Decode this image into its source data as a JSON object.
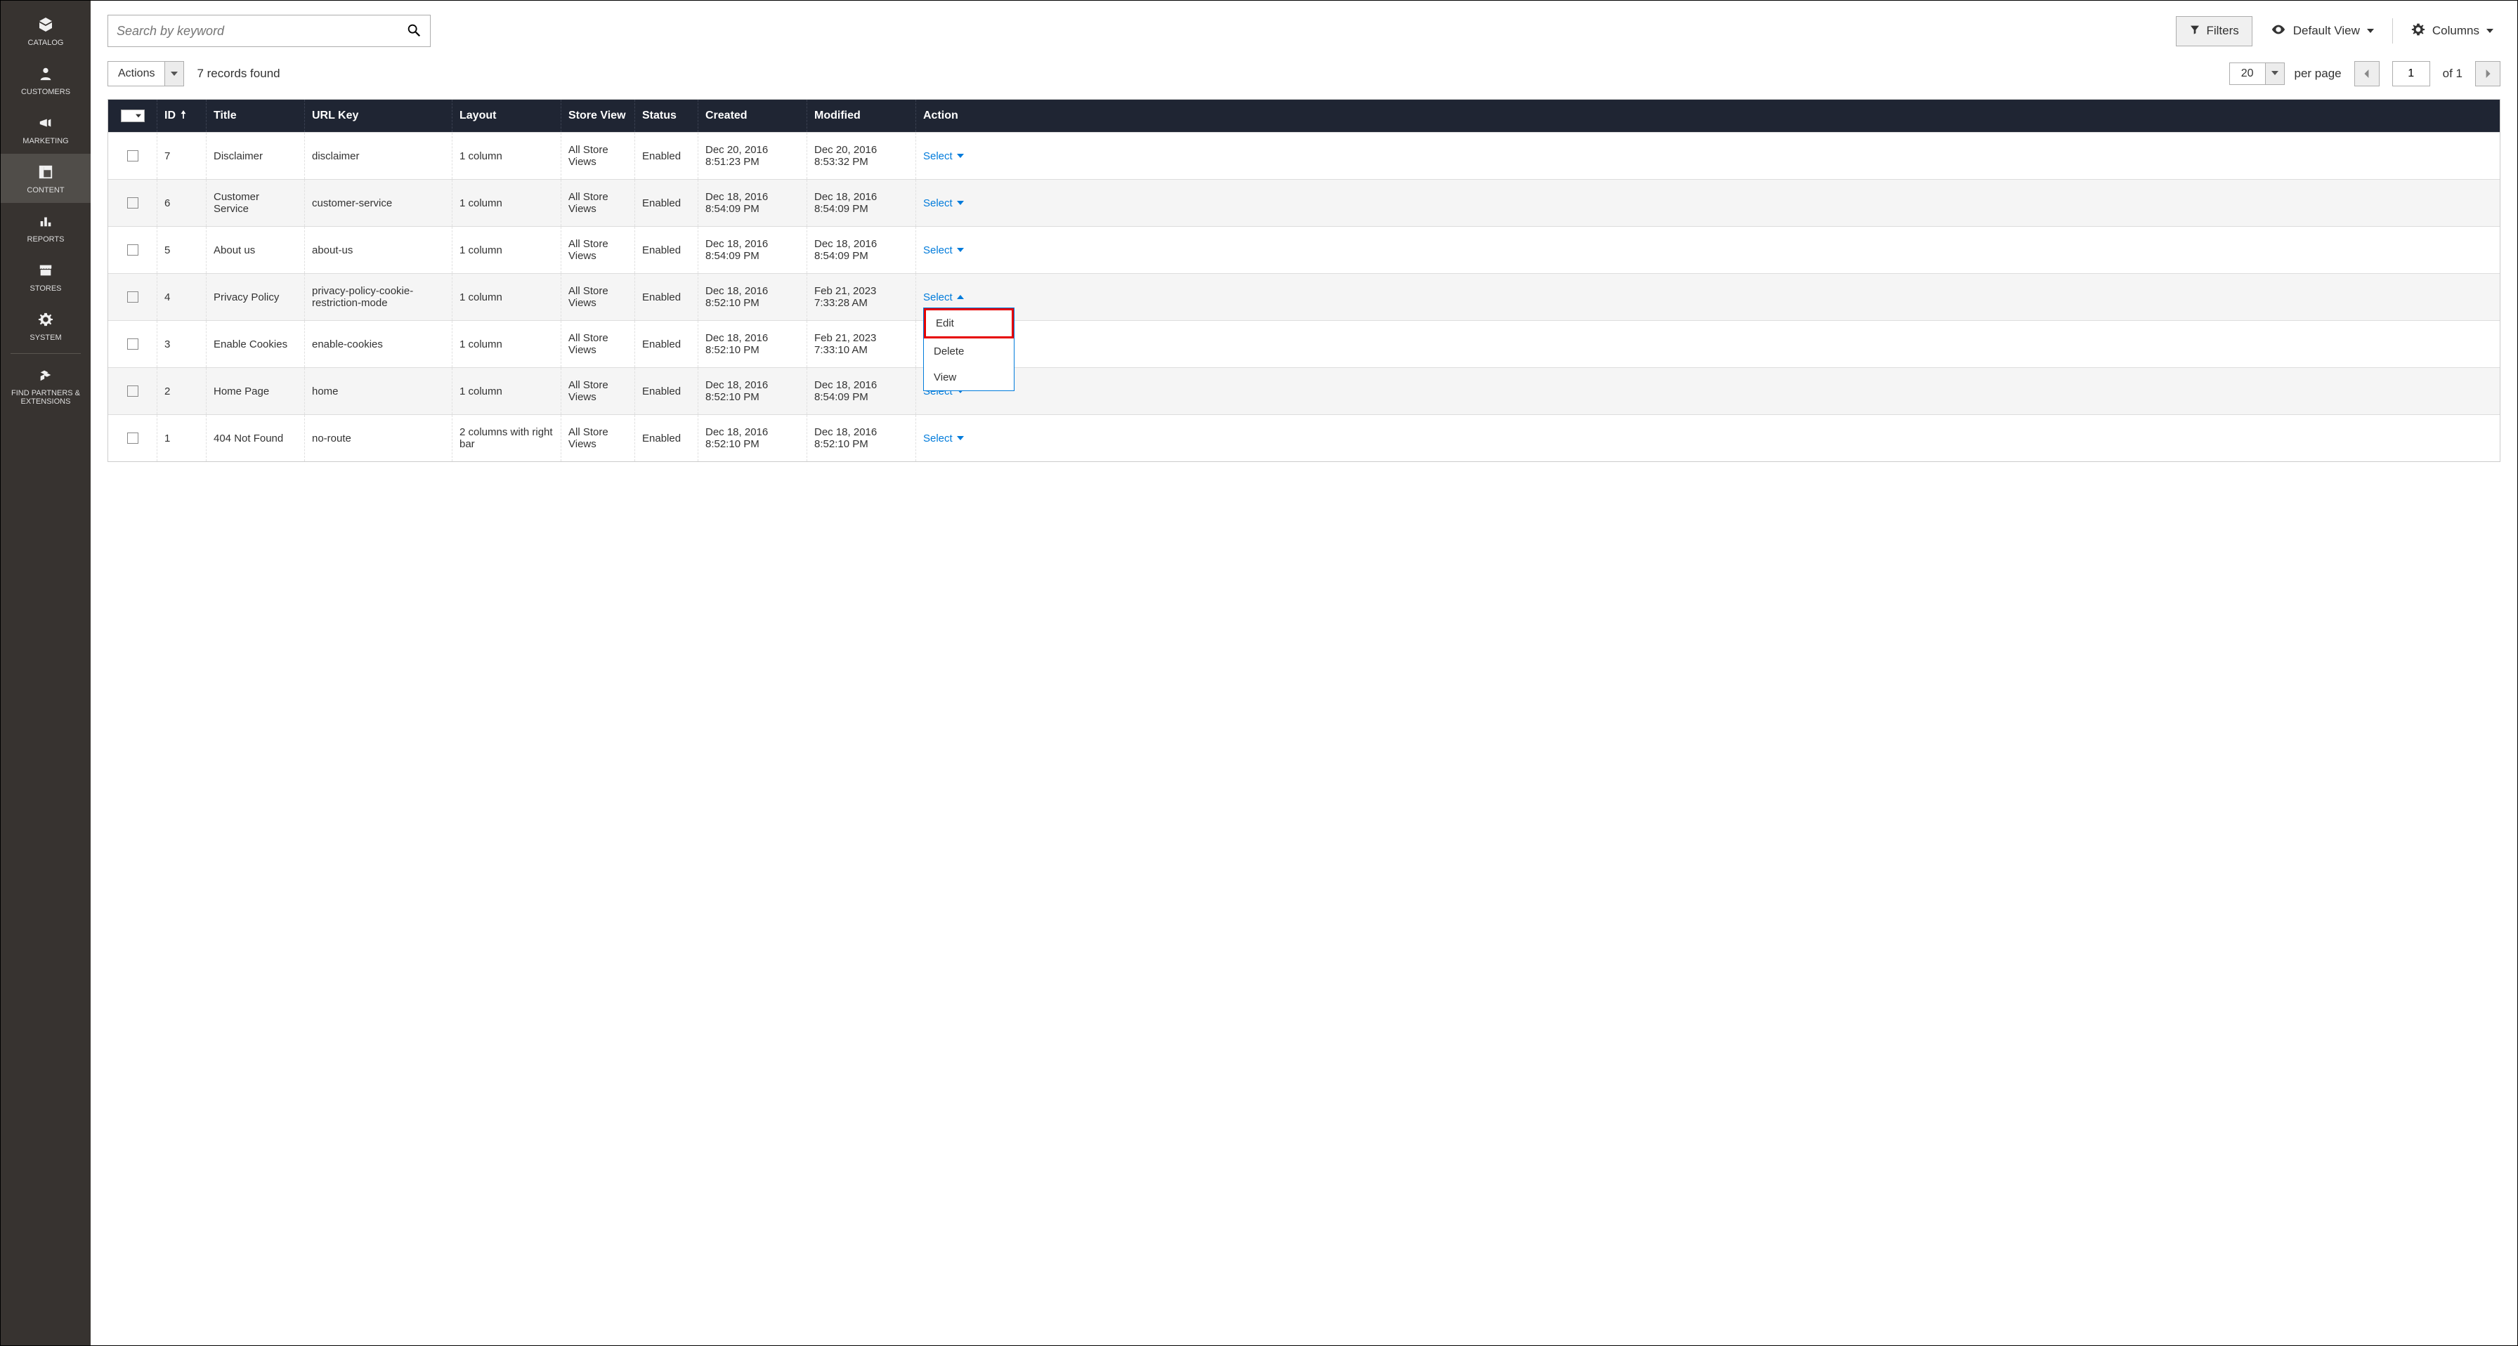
{
  "sidebar": {
    "items": [
      {
        "label": "CATALOG"
      },
      {
        "label": "CUSTOMERS"
      },
      {
        "label": "MARKETING"
      },
      {
        "label": "CONTENT"
      },
      {
        "label": "REPORTS"
      },
      {
        "label": "STORES"
      },
      {
        "label": "SYSTEM"
      },
      {
        "label": "FIND PARTNERS & EXTENSIONS"
      }
    ]
  },
  "toolbar": {
    "search_placeholder": "Search by keyword",
    "filters_label": "Filters",
    "default_view_label": "Default View",
    "columns_label": "Columns",
    "actions_label": "Actions",
    "records_found": "7 records found"
  },
  "pagination": {
    "per_page": "20",
    "per_page_label": "per page",
    "current_page": "1",
    "of_text": "of 1"
  },
  "grid": {
    "headers": [
      "ID",
      "Title",
      "URL Key",
      "Layout",
      "Store View",
      "Status",
      "Created",
      "Modified",
      "Action"
    ],
    "select_label": "Select",
    "rows": [
      {
        "id": "7",
        "title": "Disclaimer",
        "url_key": "disclaimer",
        "layout": "1 column",
        "store": "All Store Views",
        "status": "Enabled",
        "created": "Dec 20, 2016 8:51:23 PM",
        "modified": "Dec 20, 2016 8:53:32 PM",
        "open": false
      },
      {
        "id": "6",
        "title": "Customer Service",
        "url_key": "customer-service",
        "layout": "1 column",
        "store": "All Store Views",
        "status": "Enabled",
        "created": "Dec 18, 2016 8:54:09 PM",
        "modified": "Dec 18, 2016 8:54:09 PM",
        "open": false
      },
      {
        "id": "5",
        "title": "About us",
        "url_key": "about-us",
        "layout": "1 column",
        "store": "All Store Views",
        "status": "Enabled",
        "created": "Dec 18, 2016 8:54:09 PM",
        "modified": "Dec 18, 2016 8:54:09 PM",
        "open": false
      },
      {
        "id": "4",
        "title": "Privacy Policy",
        "url_key": "privacy-policy-cookie-restriction-mode",
        "layout": "1 column",
        "store": "All Store Views",
        "status": "Enabled",
        "created": "Dec 18, 2016 8:52:10 PM",
        "modified": "Feb 21, 2023 7:33:28 AM",
        "open": true
      },
      {
        "id": "3",
        "title": "Enable Cookies",
        "url_key": "enable-cookies",
        "layout": "1 column",
        "store": "All Store Views",
        "status": "Enabled",
        "created": "Dec 18, 2016 8:52:10 PM",
        "modified": "Feb 21, 2023 7:33:10 AM",
        "open": false
      },
      {
        "id": "2",
        "title": "Home Page",
        "url_key": "home",
        "layout": "1 column",
        "store": "All Store Views",
        "status": "Enabled",
        "created": "Dec 18, 2016 8:52:10 PM",
        "modified": "Dec 18, 2016 8:54:09 PM",
        "open": false
      },
      {
        "id": "1",
        "title": "404 Not Found",
        "url_key": "no-route",
        "layout": "2 columns with right bar",
        "store": "All Store Views",
        "status": "Enabled",
        "created": "Dec 18, 2016 8:52:10 PM",
        "modified": "Dec 18, 2016 8:52:10 PM",
        "open": false
      }
    ]
  },
  "action_menu": {
    "items": [
      "Edit",
      "Delete",
      "View"
    ]
  }
}
